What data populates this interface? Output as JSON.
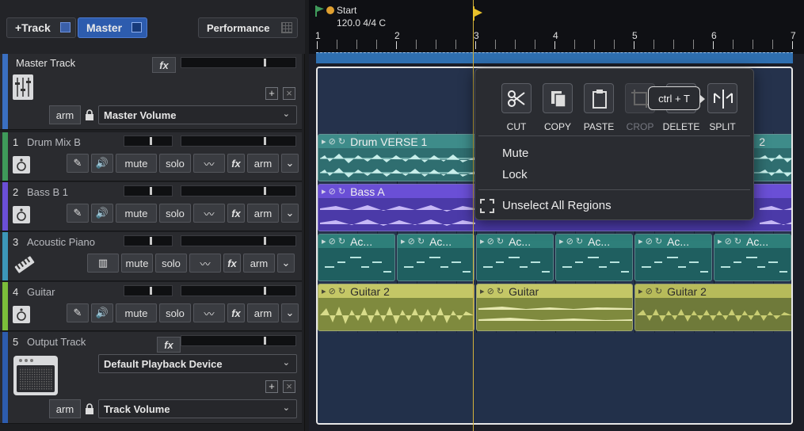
{
  "toolbar": {
    "add_track_label": "+Track",
    "master_label": "Master",
    "performance_label": "Performance"
  },
  "master_track": {
    "name": "Master Track",
    "fx_label": "fx",
    "arm_label": "arm",
    "volume_select": "Master Volume",
    "add_label": "+",
    "close_label": "×"
  },
  "tracks": [
    {
      "num": "1",
      "name": "Drum Mix B",
      "color": "#3f9a5a",
      "icon": "speaker-icon"
    },
    {
      "num": "2",
      "name": "Bass B 1",
      "color": "#6a4fd6",
      "icon": "speaker-icon"
    },
    {
      "num": "3",
      "name": "Acoustic Piano",
      "color": "#3c97b8",
      "icon": "keyboard-icon"
    },
    {
      "num": "4",
      "name": "Guitar",
      "color": "#7bbd3a",
      "icon": "speaker-icon"
    }
  ],
  "track_buttons": {
    "mute": "mute",
    "solo": "solo",
    "fx": "fx",
    "arm": "arm"
  },
  "output_track": {
    "num": "5",
    "name": "Output Track",
    "fx_label": "fx",
    "device_select": "Default Playback Device",
    "arm_label": "arm",
    "volume_select": "Track Volume",
    "add_label": "+",
    "close_label": "×"
  },
  "ruler": {
    "start_label": "Start",
    "tempo_label": "120.0 4/4 C",
    "bars": [
      "1",
      "2",
      "3",
      "4",
      "5",
      "6",
      "7"
    ]
  },
  "regions": {
    "drums": "Drum VERSE 1",
    "drums_tail": "2",
    "bass": "Bass A",
    "piano": [
      "Ac...",
      "Ac...",
      "Ac...",
      "Ac...",
      "Ac...",
      "Ac..."
    ],
    "guitar": [
      "Guitar 2",
      "Guitar",
      "Guitar 2"
    ]
  },
  "context_menu": {
    "actions": [
      {
        "label": "CUT",
        "icon": "scissors-icon",
        "enabled": true
      },
      {
        "label": "COPY",
        "icon": "copy-icon",
        "enabled": true
      },
      {
        "label": "PASTE",
        "icon": "paste-icon",
        "enabled": true
      },
      {
        "label": "CROP",
        "icon": "crop-icon",
        "enabled": false
      },
      {
        "label": "DELETE",
        "icon": "delete-icon",
        "enabled": true
      },
      {
        "label": "SPLIT",
        "icon": "split-icon",
        "enabled": true
      }
    ],
    "tooltip": "ctrl + T",
    "mute_label": "Mute",
    "lock_label": "Lock",
    "unselect_label": "Unselect All Regions"
  },
  "colors": {
    "master_blue": "#2d5cae",
    "drums": "#3e8c8a",
    "bass": "#6a4fd6",
    "piano": "#2e7f7a",
    "guitar": "#c4c766",
    "playhead": "#e7c02a"
  }
}
